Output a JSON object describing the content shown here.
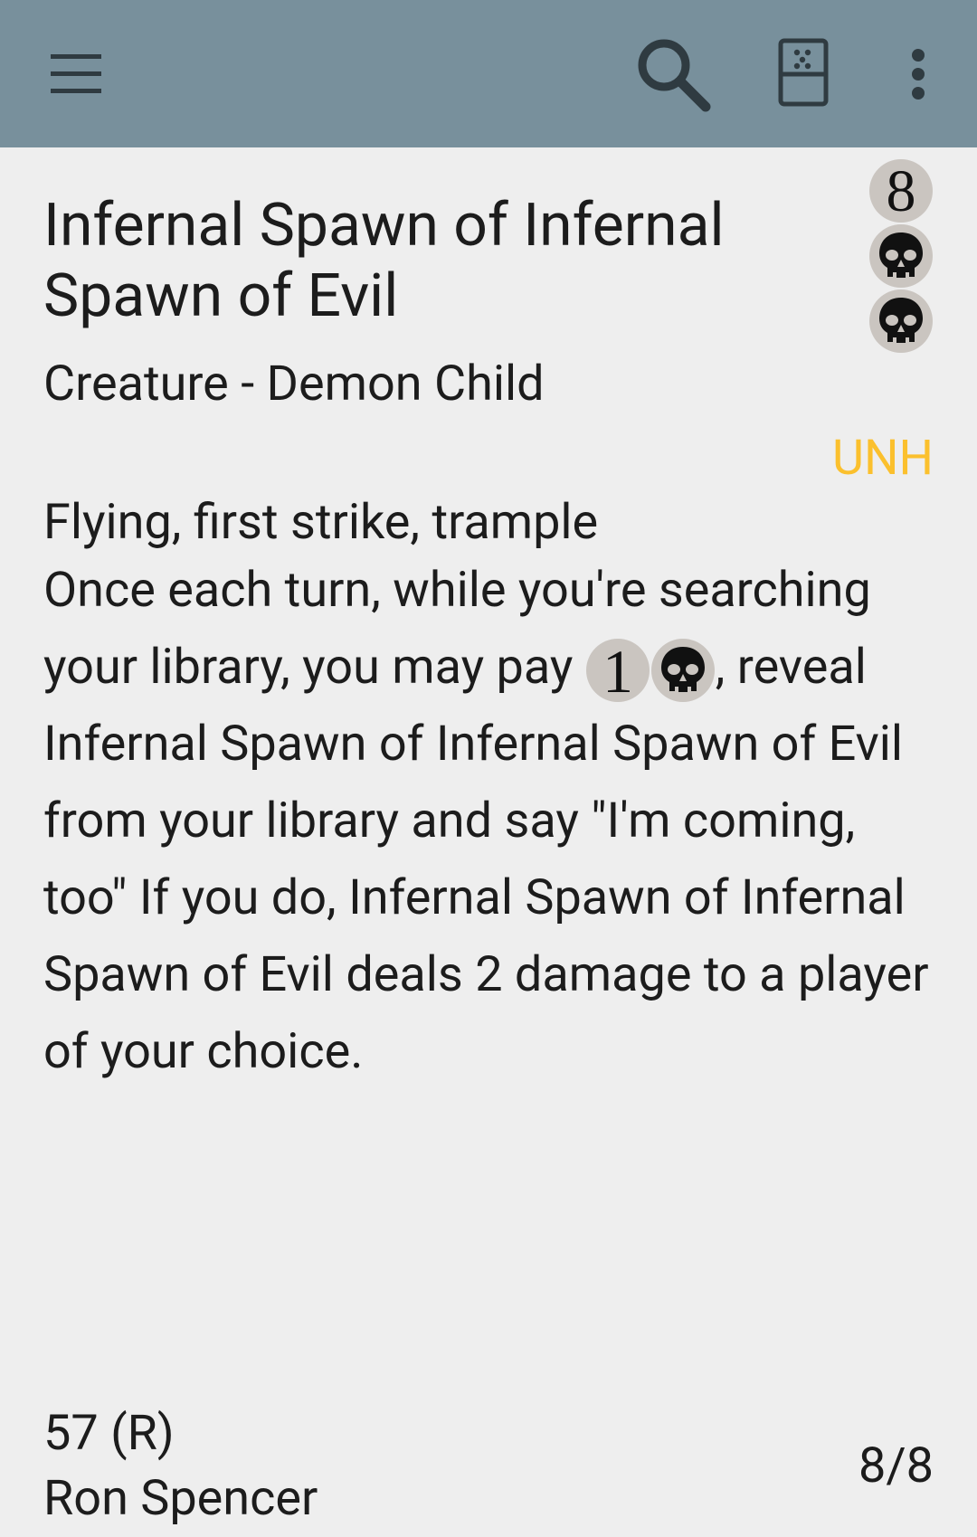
{
  "app_bar": {
    "background": "#78909c",
    "icons": [
      "menu-icon",
      "search-icon",
      "deck-icon",
      "more-vert-icon"
    ]
  },
  "card": {
    "name": "Infernal Spawn of Infernal Spawn of Evil",
    "mana_cost": [
      "8",
      "B",
      "B"
    ],
    "type_line": "Creature - Demon Child",
    "set_code": "UNH",
    "set_color": "#fbc02d",
    "rules_line1": "Flying, first strike, trample",
    "rules_line2_before": "Once each turn, while you're searching your library, you may pay ",
    "rules_cost": [
      "1",
      "B"
    ],
    "rules_line2_after": ", reveal Infernal Spawn of Infernal Spawn of Evil from your library and say \"I'm coming, too\" If you do, Infernal Spawn of Infernal Spawn of Evil deals 2 damage to a player of your choice.",
    "collector_number": "57 (R)",
    "artist": "Ron Spencer",
    "power_toughness": "8/8"
  }
}
